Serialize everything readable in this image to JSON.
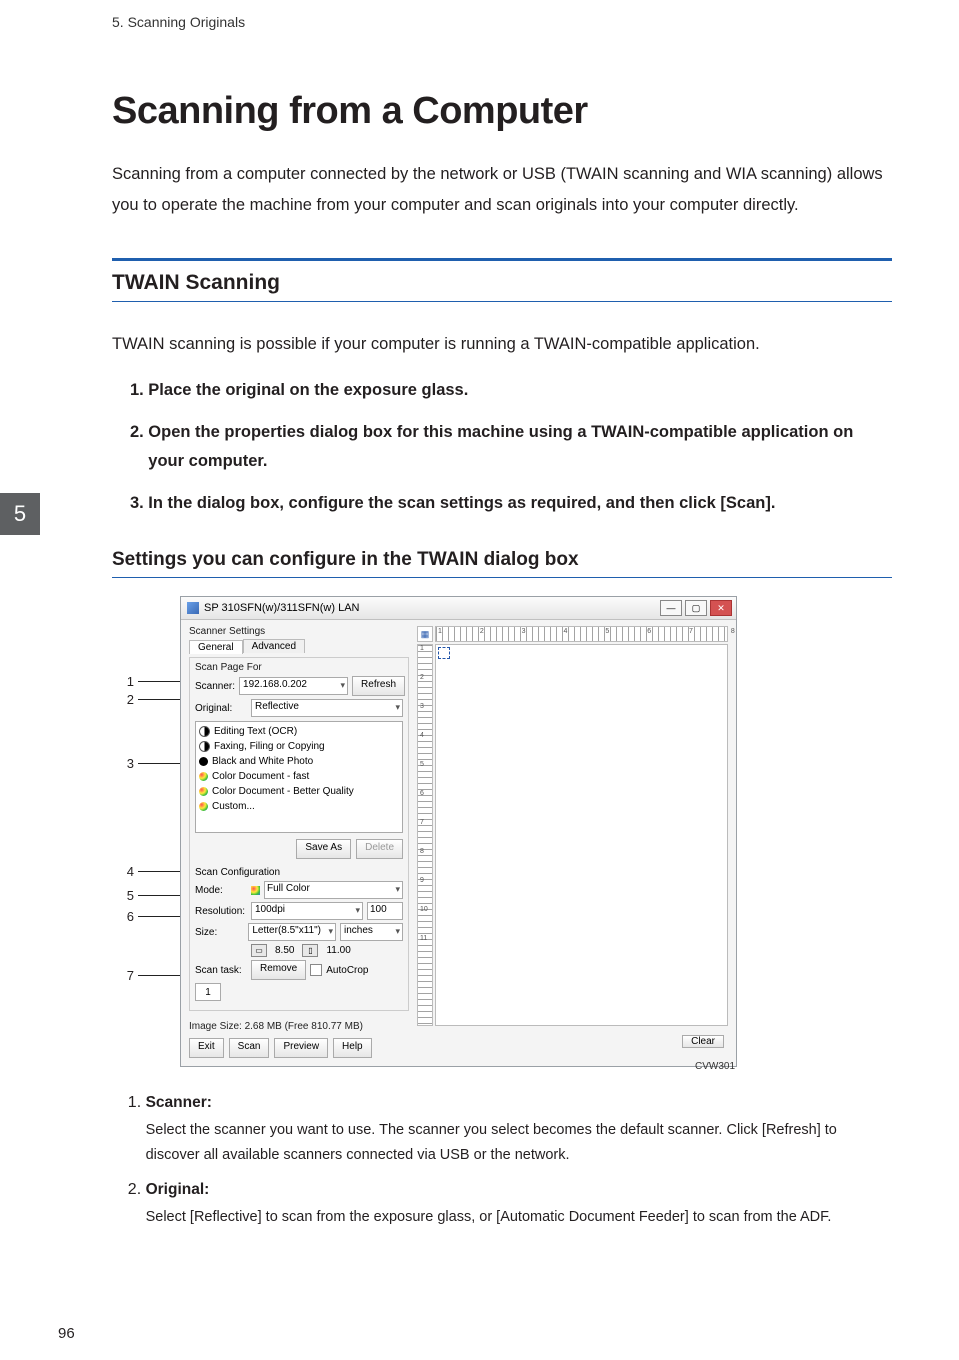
{
  "header": {
    "crumb": "5. Scanning Originals"
  },
  "side_tab": "5",
  "title": "Scanning from a Computer",
  "intro": "Scanning from a computer connected by the network or USB (TWAIN scanning and WIA scanning) allows you to operate the machine from your computer and scan originals into your computer directly.",
  "section1": {
    "heading": "TWAIN Scanning",
    "lead": "TWAIN scanning is possible if your computer is running a TWAIN-compatible application.",
    "steps": [
      "Place the original on the exposure glass.",
      "Open the properties dialog box for this machine using a TWAIN-compatible application on your computer.",
      "In the dialog box, configure the scan settings as required, and then click [Scan]."
    ]
  },
  "section2": {
    "heading": "Settings you can configure in the TWAIN dialog box"
  },
  "figure": {
    "id": "CVW301",
    "callouts": [
      "1",
      "2",
      "3",
      "4",
      "5",
      "6",
      "7"
    ],
    "dialog_title": "SP 310SFN(w)/311SFN(w) LAN",
    "scanner_settings_label": "Scanner Settings",
    "tabs": {
      "general": "General",
      "advanced": "Advanced"
    },
    "scan_page_for": "Scan Page For",
    "scanner_label": "Scanner:",
    "scanner_value": "192.168.0.202",
    "refresh": "Refresh",
    "original_label": "Original:",
    "original_value": "Reflective",
    "list": [
      "Editing Text (OCR)",
      "Faxing, Filing or Copying",
      "Black and White Photo",
      "Color Document - fast",
      "Color Document - Better Quality",
      "Custom..."
    ],
    "save_as": "Save As",
    "delete": "Delete",
    "scan_config": "Scan Configuration",
    "mode_label": "Mode:",
    "mode_value": "Full Color",
    "resolution_label": "Resolution:",
    "resolution_value": "100dpi",
    "resolution_num": "100",
    "size_label": "Size:",
    "size_value": "Letter(8.5\"x11\")",
    "units": "inches",
    "width": "8.50",
    "height": "11.00",
    "scan_task_label": "Scan task:",
    "remove": "Remove",
    "autocrop": "AutoCrop",
    "task_val": "1",
    "image_size": "Image Size: 2.68 MB (Free 810.77 MB)",
    "exit": "Exit",
    "scan": "Scan",
    "preview": "Preview",
    "help": "Help",
    "clear": "Clear",
    "ruler_h": "1 2 3 4 5 6 7 8",
    "ruler_v": [
      "1",
      "2",
      "3",
      "4",
      "5",
      "6",
      "7",
      "8",
      "9",
      "10",
      "11"
    ]
  },
  "defs": [
    {
      "term": "Scanner:",
      "body": "Select the scanner you want to use. The scanner you select becomes the default scanner. Click [Refresh] to discover all available scanners connected via USB or the network."
    },
    {
      "term": "Original:",
      "body": "Select [Reflective] to scan from the exposure glass, or [Automatic Document Feeder] to scan from the ADF."
    }
  ],
  "page_number": "96"
}
